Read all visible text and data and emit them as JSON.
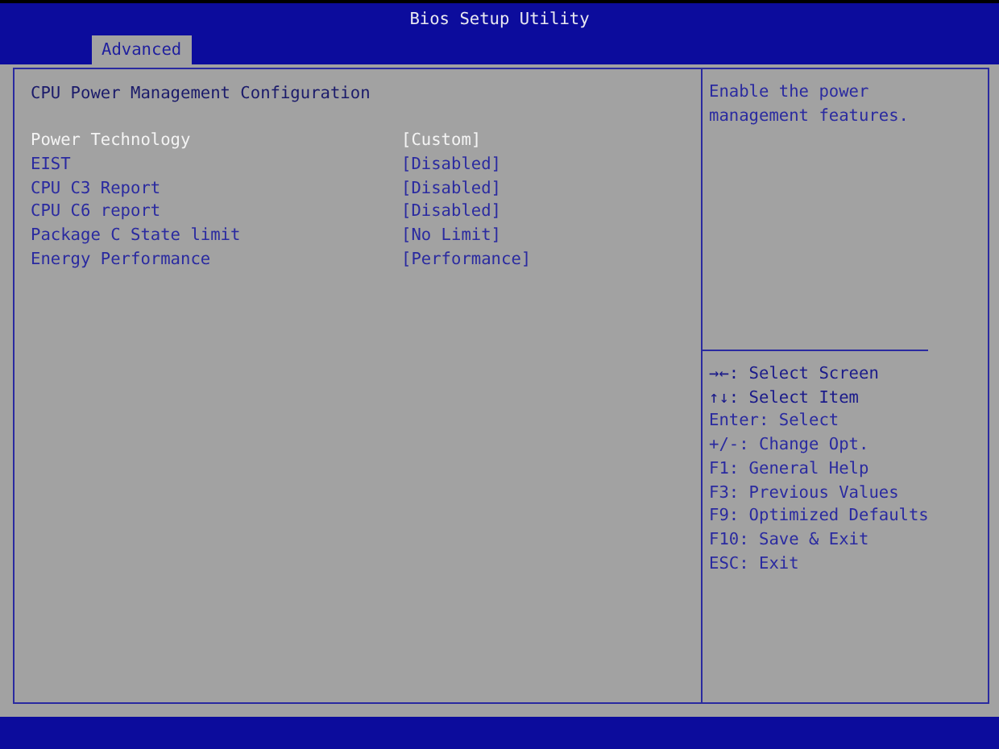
{
  "window": {
    "title": "Bios Setup Utility"
  },
  "tabs": [
    {
      "label": "Advanced",
      "selected": true
    }
  ],
  "section_title": "CPU Power Management Configuration",
  "settings": [
    {
      "label": "Power Technology",
      "value": "[Custom]",
      "selected": true
    },
    {
      "label": "EIST",
      "value": "[Disabled]",
      "selected": false
    },
    {
      "label": "CPU C3 Report",
      "value": "[Disabled]",
      "selected": false
    },
    {
      "label": "CPU C6 report",
      "value": "[Disabled]",
      "selected": false
    },
    {
      "label": "Package C State limit",
      "value": "[No Limit]",
      "selected": false
    },
    {
      "label": "Energy Performance",
      "value": "[Performance]",
      "selected": false
    }
  ],
  "help_text": "Enable the power management features.",
  "key_legend": [
    {
      "text": "→←: Select Screen",
      "kind": "arrow"
    },
    {
      "text": "↑↓: Select Item",
      "kind": "arrow"
    },
    {
      "text": "Enter: Select",
      "kind": "plain"
    },
    {
      "text": "+/-: Change Opt.",
      "kind": "plain"
    },
    {
      "text": "F1: General Help",
      "kind": "plain"
    },
    {
      "text": "F3: Previous Values",
      "kind": "plain"
    },
    {
      "text": "F9: Optimized Defaults",
      "kind": "plain"
    },
    {
      "text": "F10: Save & Exit",
      "kind": "plain"
    },
    {
      "text": "ESC: Exit",
      "kind": "plain"
    }
  ]
}
